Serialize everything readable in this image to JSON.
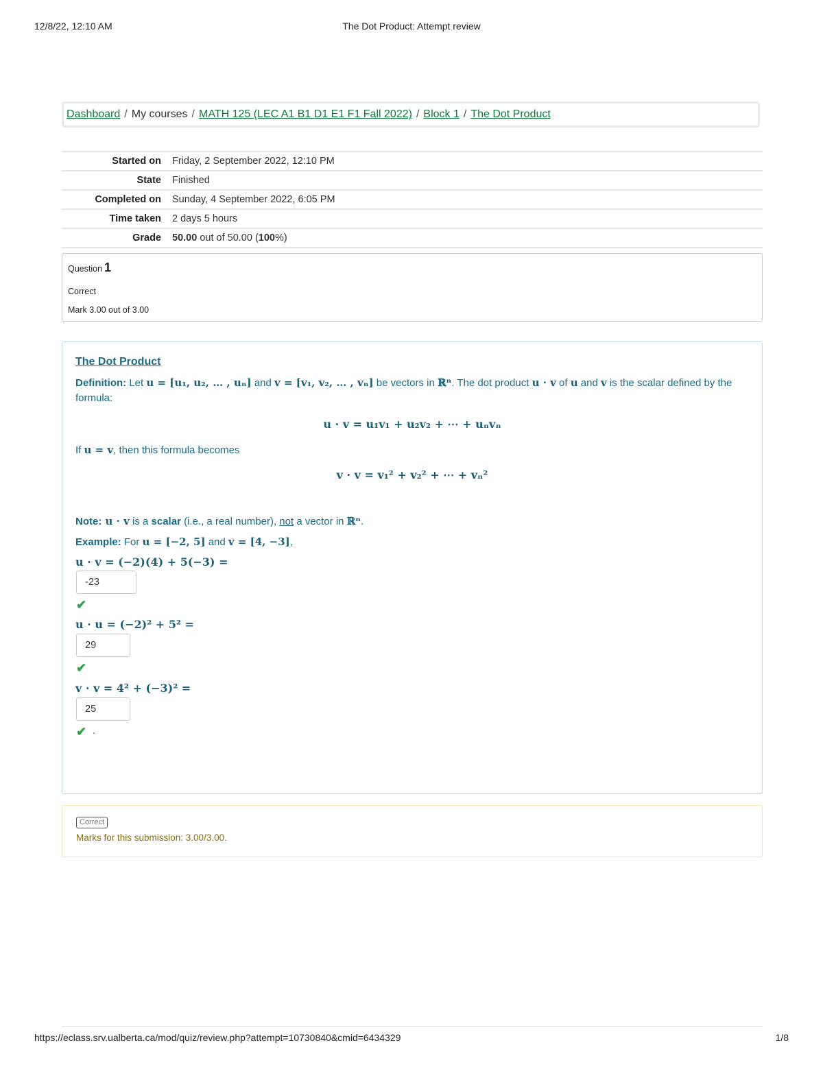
{
  "print_header": {
    "datetime": "12/8/22, 12:10 AM",
    "title": "The Dot Product: Attempt review"
  },
  "print_footer": {
    "url": "https://eclass.srv.ualberta.ca/mod/quiz/review.php?attempt=10730840&cmid=6434329",
    "page": "1/8"
  },
  "breadcrumb": {
    "items": [
      {
        "label": "Dashboard",
        "link": true
      },
      {
        "label": "My courses",
        "link": false
      },
      {
        "label": "MATH 125 (LEC A1 B1 D1 E1 F1 Fall 2022)",
        "link": true
      },
      {
        "label": "Block 1",
        "link": true
      },
      {
        "label": "The Dot Product",
        "link": true
      }
    ],
    "separator": "/"
  },
  "summary": [
    {
      "label": "Started on",
      "value": "Friday, 2 September 2022, 12:10 PM"
    },
    {
      "label": "State",
      "value": "Finished"
    },
    {
      "label": "Completed on",
      "value": "Sunday, 4 September 2022, 6:05 PM"
    },
    {
      "label": "Time taken",
      "value": "2 days 5 hours"
    },
    {
      "label": "Grade",
      "value_bold": "50.00",
      "value_rest": " out of 50.00 (",
      "value_pct": "100",
      "value_end": "%)"
    }
  ],
  "question": {
    "label": "Question",
    "number": "1",
    "state": "Correct",
    "grade": "Mark 3.00 out of 3.00"
  },
  "content": {
    "title": "The Dot Product",
    "definition_label": "Definition:",
    "def_t1": " Let ",
    "def_m1": "u = [u₁, u₂, … , uₙ]",
    "def_t2": " and ",
    "def_m2": "v = [v₁, v₂, … , vₙ]",
    "def_t3": " be vectors in ",
    "def_m3": "ℝⁿ",
    "def_t4": ". The dot product ",
    "def_m4": "u · v",
    "def_t5": " of ",
    "def_m5": "u",
    "def_t6": " and ",
    "def_m6": "v",
    "def_t7": " is the scalar defined by the",
    "def_line2": "formula:",
    "formula1": "u · v = u₁v₁ + u₂v₂ + ⋯ + uₙvₙ",
    "if_t1": "If ",
    "if_m": "u = v",
    "if_t2": ", then this formula becomes",
    "formula2": "v · v = v₁² + v₂² + ⋯ + vₙ²",
    "note_label": "Note:",
    "note_m1": " u · v",
    "note_t1": " is a ",
    "note_scalar": "scalar",
    "note_t2": " (i.e., a real number), ",
    "note_not": "not",
    "note_t3": " a vector in ",
    "note_m2": "ℝⁿ",
    "note_t4": ".",
    "example_label": "Example:",
    "ex_t1": " For ",
    "ex_m1": "u = [−2, 5]",
    "ex_t2": " and ",
    "ex_m2": "v = [4, −3]",
    "ex_t3": ",",
    "q1_expr": "u · v = (−2)(4) + 5(−3) =",
    "q1_answer": "-23",
    "q2_expr": "u · u = (−2)² + 5² =",
    "q2_answer": "29",
    "q3_expr": "v · v = 4² + (−3)² =",
    "q3_answer": "25",
    "trailing_dot": "."
  },
  "feedback": {
    "badge": "Correct",
    "marks": "Marks for this submission: 3.00/3.00."
  },
  "colors": {
    "link_green": "#0f7a3c",
    "content_blue": "#1a6a89",
    "check_green": "#2aa34a",
    "feedback_text": "#8a6d0b"
  },
  "icons": {
    "check": "check-icon"
  }
}
